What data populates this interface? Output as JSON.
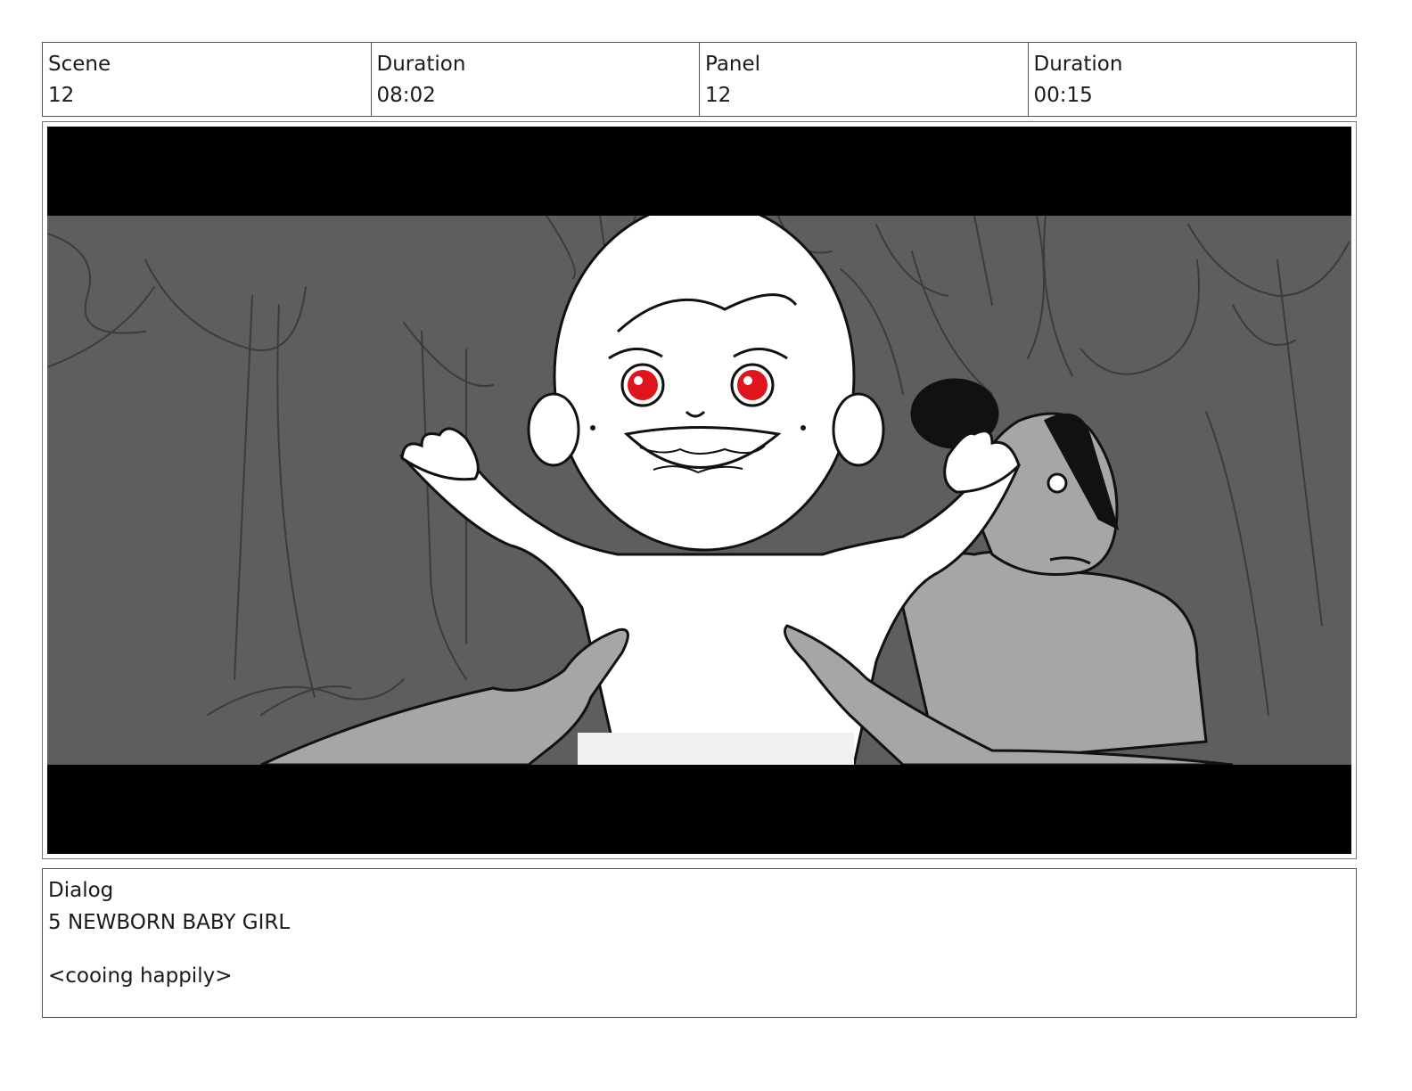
{
  "header": {
    "cells": [
      {
        "label": "Scene",
        "value": "12"
      },
      {
        "label": "Duration",
        "value": "08:02"
      },
      {
        "label": "Panel",
        "value": "12"
      },
      {
        "label": "Duration",
        "value": "00:15"
      }
    ]
  },
  "panel": {
    "letterbox_color": "#000000",
    "background_color": "#5e5e5e",
    "baby_fill": "#ffffff",
    "eye_color": "#e0141c",
    "figure_fill": "#a6a6a6"
  },
  "dialog": {
    "label": "Dialog",
    "speaker": "5 NEWBORN BABY GIRL",
    "line": "<cooing happily>"
  }
}
